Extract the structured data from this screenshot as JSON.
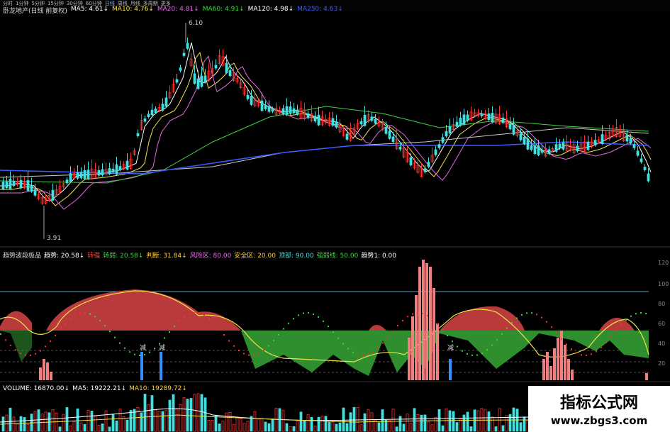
{
  "tabs": [
    "分时",
    "1分钟",
    "5分钟",
    "15分钟",
    "30分钟",
    "60分钟",
    "日线",
    "周线",
    "月线",
    "多周期",
    "更多"
  ],
  "active_tab": "日线",
  "main": {
    "stock": "卧龙地产(日线 前复权)",
    "ma": [
      {
        "label": "MA5: 4.61↓",
        "color": "#ffffff"
      },
      {
        "label": "MA10: 4.76↓",
        "color": "#f5e04a"
      },
      {
        "label": "MA20: 4.81↓",
        "color": "#e06ce0"
      },
      {
        "label": "MA60: 4.91↓",
        "color": "#40d040"
      },
      {
        "label": "MA120: 4.98↓",
        "color": "#ffffff"
      },
      {
        "label": "MA250: 4.63↓",
        "color": "#3a5cff"
      }
    ],
    "high_label": "6.10",
    "low_label": "3.91"
  },
  "indicator": {
    "name": "趋势波段极品",
    "items": [
      {
        "label": "趋势: 20.58↓",
        "color": "#ffffff"
      },
      {
        "label": "转强",
        "color": "#ff4040"
      },
      {
        "label": "转弱: 20.58↓",
        "color": "#40d040"
      },
      {
        "label": "判断: 31.84↓",
        "color": "#ffd040"
      },
      {
        "label": "风险区: 80.00",
        "color": "#ff60ff"
      },
      {
        "label": "安全区: 20.00",
        "color": "#ffd040"
      },
      {
        "label": "顶部: 90.00",
        "color": "#40e0e0"
      },
      {
        "label": "强弱线: 50.00",
        "color": "#40d040"
      },
      {
        "label": "趋势1: 0.00",
        "color": "#ffffff"
      }
    ],
    "marks": [
      "减",
      "减",
      "减"
    ],
    "scale": [
      "120",
      "100",
      "80",
      "60",
      "40",
      "20"
    ]
  },
  "volume": {
    "items": [
      {
        "label": "VOLUME: 16870.00↓",
        "color": "#ffffff"
      },
      {
        "label": "MA5: 19222.21↓",
        "color": "#ffffff"
      },
      {
        "label": "MA10: 19289.72↓",
        "color": "#ffd040"
      }
    ]
  },
  "watermark": {
    "title": "指标公式网",
    "url": "www.zbgs3.com"
  },
  "colors": {
    "up": "#ff3030",
    "down": "#40e0e0",
    "panel_red": "#c84040",
    "panel_green": "#2f8f2f"
  }
}
